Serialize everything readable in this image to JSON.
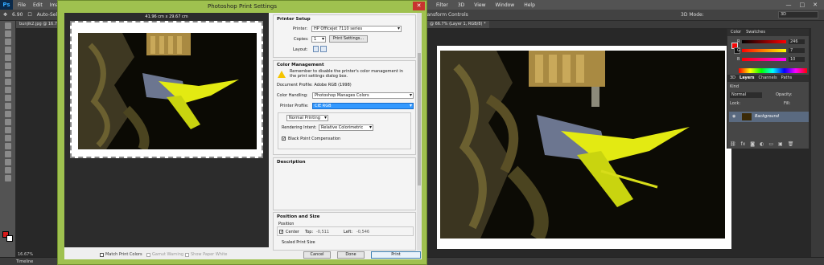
{
  "app": {
    "logo": "Ps",
    "menu": [
      "File",
      "Edit",
      "Image"
    ],
    "menu_right": [
      "Filter",
      "3D",
      "View",
      "Window",
      "Help"
    ],
    "window_controls": [
      "—",
      "□",
      "✕"
    ]
  },
  "options_bar": {
    "size": "6.90",
    "auto_select": "Auto-Select:",
    "transform_controls": "ransform Controls",
    "mode_3d": "3D Mode:",
    "workspace": "3D"
  },
  "document_tabs": {
    "left": "bunjik2.jpg @ 16.7%",
    "right": "@ 66.7% (Layer 1, RGB/8) *"
  },
  "status": {
    "zoom": "16.67%"
  },
  "timeline": {
    "label": "Timeline"
  },
  "dialog": {
    "title": "Photoshop Print Settings",
    "close": "✕",
    "preview_dims": "41.96 cm x 29.67 cm",
    "printer_setup": {
      "title": "Printer Setup",
      "printer_label": "Printer:",
      "printer_value": "HP Officejet 7110 series",
      "copies_label": "Copies:",
      "copies_value": "1",
      "print_settings_button": "Print Settings...",
      "layout_label": "Layout:"
    },
    "color_management": {
      "title": "Color Management",
      "warning": "Remember to disable the printer's color management in the print settings dialog box.",
      "document_profile": "Document Profile: Adobe RGB (1998)",
      "color_handling_label": "Color Handling:",
      "color_handling_value": "Photoshop Manages Colors",
      "printer_profile_label": "Printer Profile:",
      "printer_profile_value": "CIE RGB",
      "normal_printing": "Normal Printing",
      "rendering_intent_label": "Rendering Intent:",
      "rendering_intent_value": "Relative Colorimetric",
      "black_point_label": "Black Point Compensation",
      "black_point_checked": true
    },
    "description": {
      "title": "Description"
    },
    "position_size": {
      "title": "Position and Size",
      "position_label": "Position",
      "center_label": "Center",
      "center_checked": true,
      "top_label": "Top:",
      "top_value": "-0,511",
      "left_label": "Left:",
      "left_value": "-0,546",
      "scaled_label": "Scaled Print Size"
    },
    "footer": {
      "match_print_colors": "Match Print Colors",
      "gamut_warning": "Gamut Warning",
      "show_paper_white": "Show Paper White",
      "cancel": "Cancel",
      "done": "Done",
      "print": "Print"
    }
  },
  "panels": {
    "color_tab": "Color",
    "swatches_tab": "Swatches",
    "r_label": "R",
    "g_label": "G",
    "b_label": "B",
    "r_value": "246",
    "g_value": "7",
    "b_value": "10",
    "fg_color": "#f6070a",
    "layers_tabs": [
      "3D",
      "Layers",
      "Channels",
      "Paths"
    ],
    "kind_label": "Kind",
    "blend_mode": "Normal",
    "opacity_label": "Opacity:",
    "lock_label": "Lock:",
    "fill_label": "Fill:",
    "layer_name": "Background"
  }
}
